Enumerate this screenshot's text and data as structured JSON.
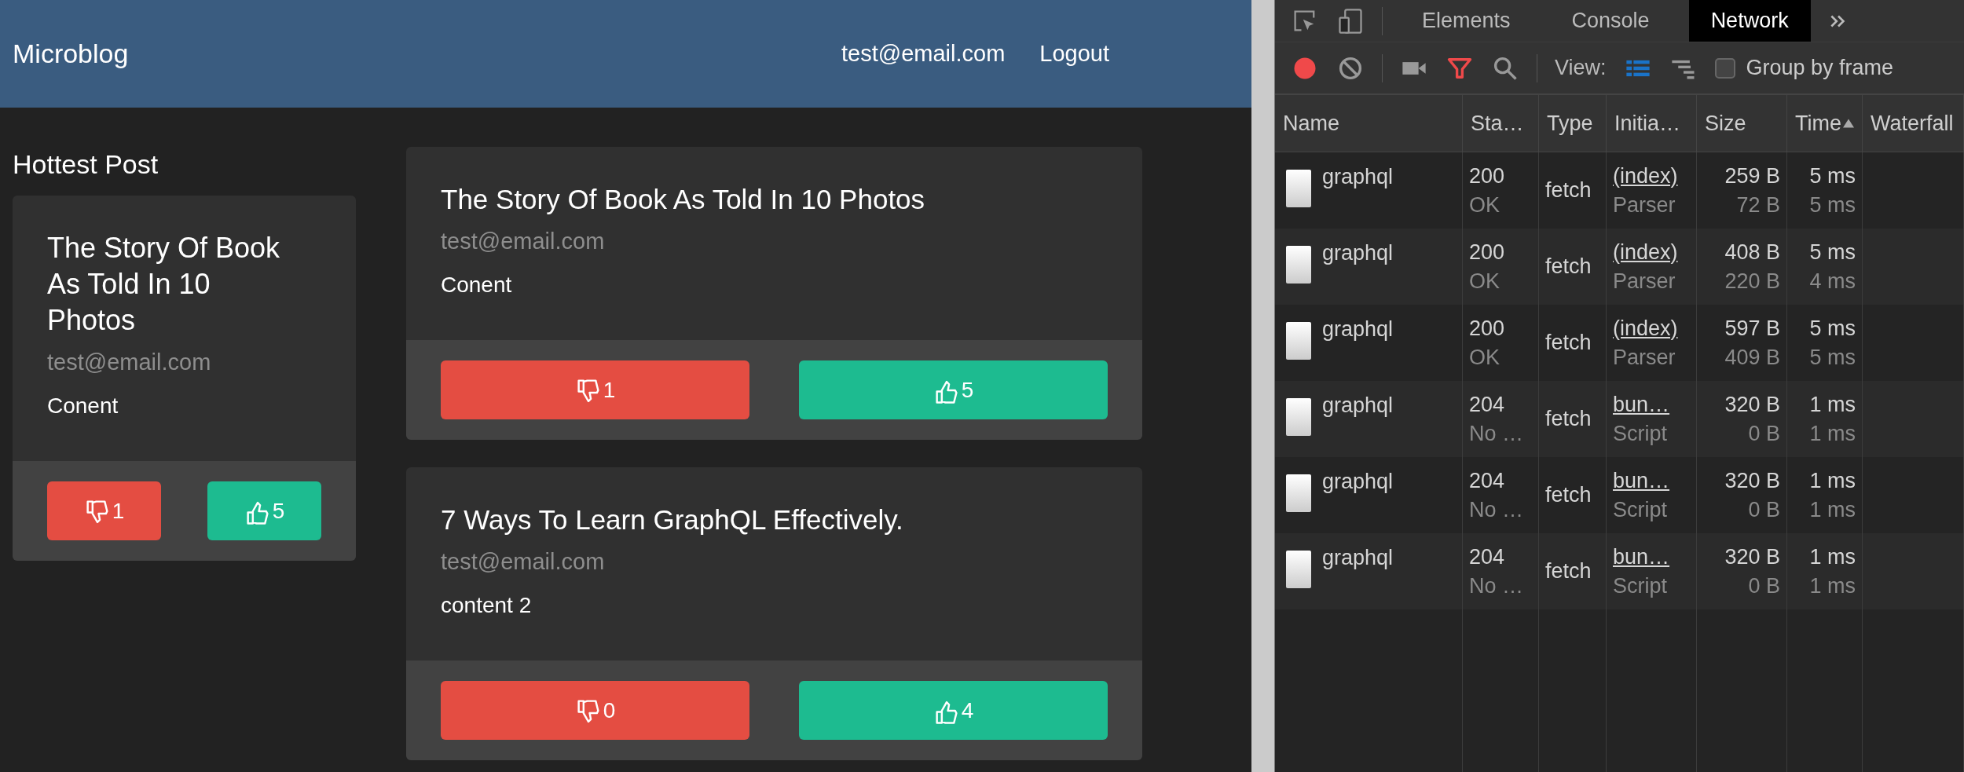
{
  "navbar": {
    "brand": "Microblog",
    "links": [
      "test@email.com",
      "Logout"
    ]
  },
  "hottest": {
    "heading": "Hottest Post",
    "post": {
      "title": "The Story Of Book As Told In 10 Photos",
      "author": "test@email.com",
      "content": "Conent",
      "dislikes": "1",
      "likes": "5"
    }
  },
  "posts": [
    {
      "title": "The Story Of Book As Told In 10 Photos",
      "author": "test@email.com",
      "content": "Conent",
      "dislikes": "1",
      "likes": "5"
    },
    {
      "title": "7 Ways To Learn GraphQL Effectively.",
      "author": "test@email.com",
      "content": "content 2",
      "dislikes": "0",
      "likes": "4"
    }
  ],
  "devtools": {
    "tabs": [
      {
        "label": "Elements",
        "selected": false
      },
      {
        "label": "Console",
        "selected": false
      },
      {
        "label": "Network",
        "selected": true
      }
    ],
    "toolbar": {
      "view_label": "View:",
      "group_by_frame": {
        "label": "Group by frame",
        "checked": false
      }
    },
    "columns": [
      {
        "label": "Name",
        "sorted": false
      },
      {
        "label": "Sta…",
        "sorted": false
      },
      {
        "label": "Type",
        "sorted": false
      },
      {
        "label": "Initia…",
        "sorted": false
      },
      {
        "label": "Size",
        "sorted": false
      },
      {
        "label": "Time",
        "sorted": true
      },
      {
        "label": "Waterfall",
        "sorted": false
      }
    ],
    "rows": [
      {
        "name": "graphql",
        "status": "200",
        "status_text": "OK",
        "type": "fetch",
        "initiator": "(index)",
        "cause": "Parser",
        "size": "259 B",
        "resource_size": "72 B",
        "time": "5 ms",
        "latency": "5 ms"
      },
      {
        "name": "graphql",
        "status": "200",
        "status_text": "OK",
        "type": "fetch",
        "initiator": "(index)",
        "cause": "Parser",
        "size": "408 B",
        "resource_size": "220 B",
        "time": "5 ms",
        "latency": "4 ms"
      },
      {
        "name": "graphql",
        "status": "200",
        "status_text": "OK",
        "type": "fetch",
        "initiator": "(index)",
        "cause": "Parser",
        "size": "597 B",
        "resource_size": "409 B",
        "time": "5 ms",
        "latency": "5 ms"
      },
      {
        "name": "graphql",
        "status": "204",
        "status_text": "No …",
        "type": "fetch",
        "initiator": "bun…",
        "cause": "Script",
        "size": "320 B",
        "resource_size": "0 B",
        "time": "1 ms",
        "latency": "1 ms"
      },
      {
        "name": "graphql",
        "status": "204",
        "status_text": "No …",
        "type": "fetch",
        "initiator": "bun…",
        "cause": "Script",
        "size": "320 B",
        "resource_size": "0 B",
        "time": "1 ms",
        "latency": "1 ms"
      },
      {
        "name": "graphql",
        "status": "204",
        "status_text": "No …",
        "type": "fetch",
        "initiator": "bun…",
        "cause": "Script",
        "size": "320 B",
        "resource_size": "0 B",
        "time": "1 ms",
        "latency": "1 ms"
      }
    ]
  }
}
